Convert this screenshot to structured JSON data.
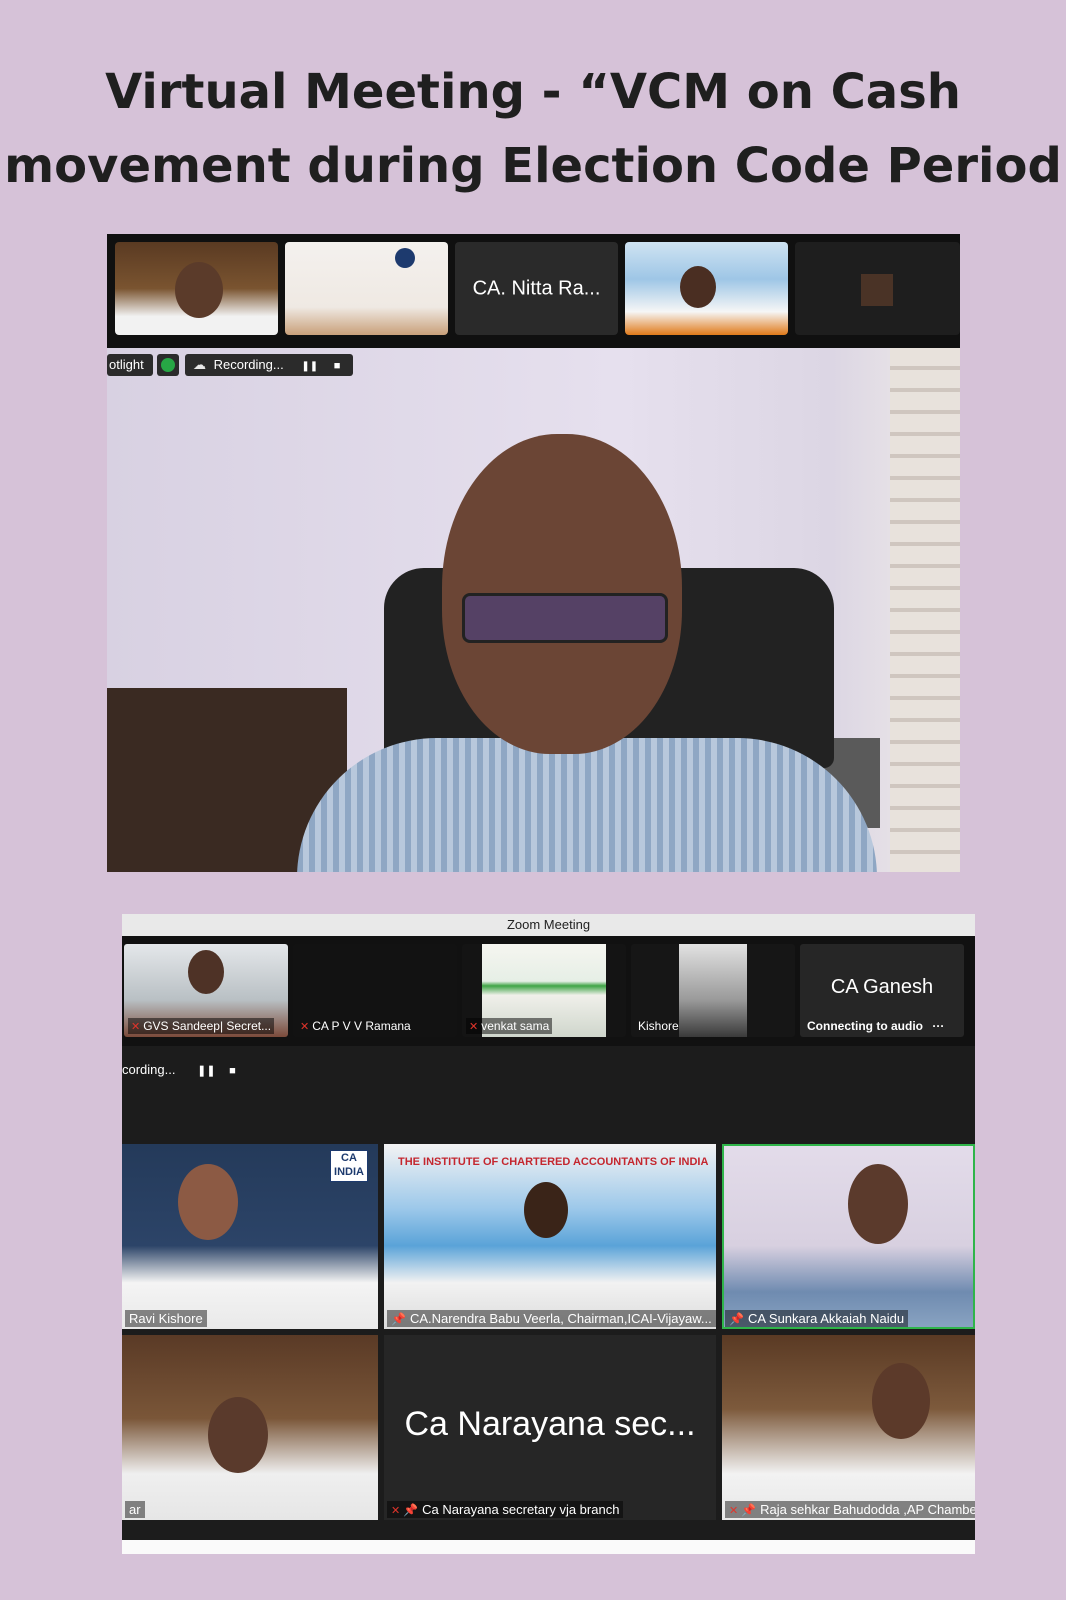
{
  "poster": {
    "title_line1": "Virtual Meeting - “VCM on Cash",
    "title_line2": "movement during Election Code Period"
  },
  "screenshot1": {
    "thumbnails": [
      {
        "type": "video",
        "label": ""
      },
      {
        "type": "video",
        "label": ""
      },
      {
        "type": "name",
        "label": "CA. Nitta Ra..."
      },
      {
        "type": "video",
        "label": ""
      },
      {
        "type": "video",
        "label": ""
      }
    ],
    "toolbar": {
      "spotlight_label": "otlight",
      "recording_label": "Recording...",
      "pause_glyph": "❚❚",
      "stop_glyph": "■"
    },
    "colors": {
      "active_border": "#2fb54a",
      "shield": "#27a745"
    }
  },
  "screenshot2": {
    "window_title": "Zoom Meeting",
    "recording_label": "cording...",
    "pause_glyph": "❚❚",
    "stop_glyph": "■",
    "top_strip": [
      {
        "name": "GVS Sandeep| Secret...",
        "muted": true
      },
      {
        "name": "CA P V V Ramana",
        "muted": true
      },
      {
        "name": "venkat sama",
        "muted": true
      },
      {
        "name": "Kishore",
        "muted": false
      },
      {
        "name": "CA Ganesh",
        "status": "Connecting to audio",
        "more": "···"
      }
    ],
    "gallery": [
      {
        "name": "Ravi Kishore"
      },
      {
        "name": "CA.Narendra Babu Veerla, Chairman,ICAI-Vijayaw..."
      },
      {
        "name": "CA Sunkara Akkaiah Naidu",
        "active_speaker": true
      },
      {
        "name": "ar"
      },
      {
        "name": "Ca Narayana secretary vja branch",
        "big_label": "Ca Narayana sec..."
      },
      {
        "name": "Raja sehkar Bahudodda ,AP Chamber"
      }
    ],
    "badge_text": "CA\nINDIA",
    "banner_text": "THE INSTITUTE OF CHARTERED ACCOUNTANTS OF INDIA"
  }
}
